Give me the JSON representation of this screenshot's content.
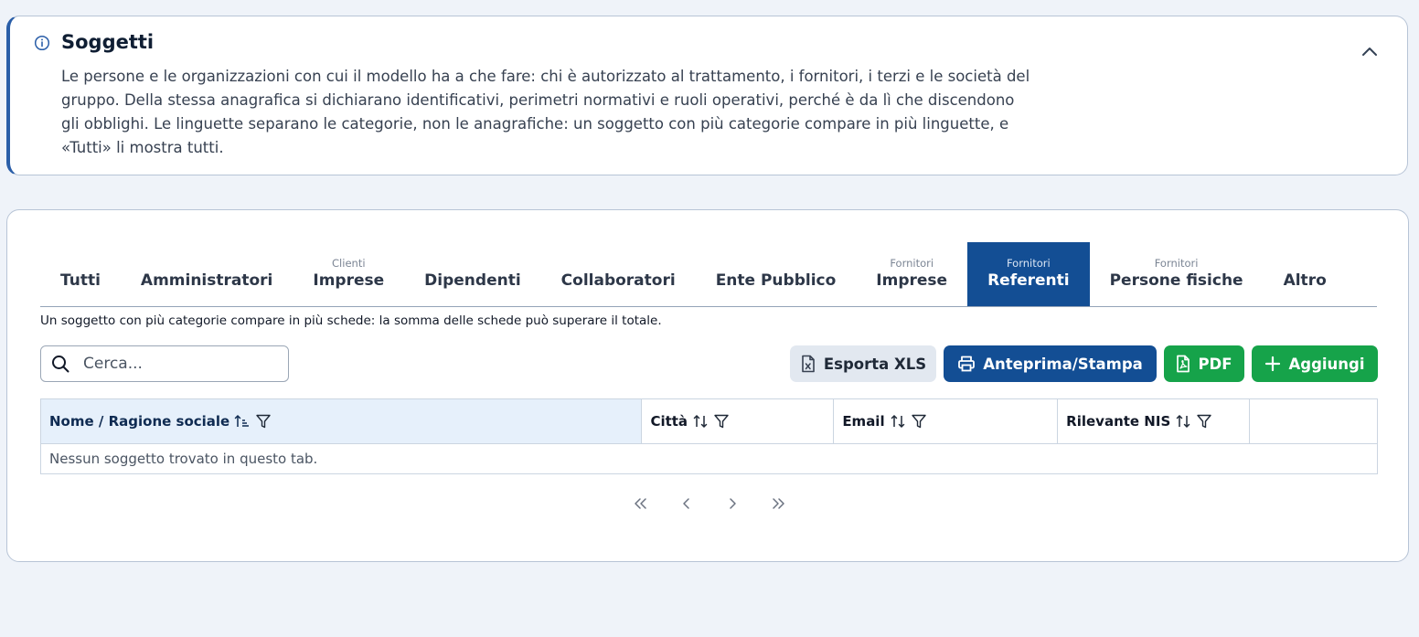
{
  "info": {
    "title": "Soggetti",
    "text": "Le persone e le organizzazioni con cui il modello ha a che fare: chi è autorizzato al trattamento, i fornitori, i terzi e le società del gruppo. Della stessa anagrafica si dichiarano identificativi, perimetri normativi e ruoli operativi, perché è da lì che discendono gli obblighi. Le linguette separano le categorie, non le anagrafiche: un soggetto con più categorie compare in più linguette, e «Tutti» li mostra tutti."
  },
  "tabs": [
    {
      "sub": "",
      "label": "Tutti"
    },
    {
      "sub": "",
      "label": "Amministratori"
    },
    {
      "sub": "Clienti",
      "label": "Imprese"
    },
    {
      "sub": "",
      "label": "Dipendenti"
    },
    {
      "sub": "",
      "label": "Collaboratori"
    },
    {
      "sub": "",
      "label": "Ente Pubblico"
    },
    {
      "sub": "Fornitori",
      "label": "Imprese"
    },
    {
      "sub": "Fornitori",
      "label": "Referenti"
    },
    {
      "sub": "Fornitori",
      "label": "Persone fisiche"
    },
    {
      "sub": "",
      "label": "Altro"
    }
  ],
  "active_tab": 7,
  "note": "Un soggetto con più categorie compare in più schede: la somma delle schede può superare il totale.",
  "search": {
    "placeholder": "Cerca..."
  },
  "toolbar": {
    "xls_label": "Esporta XLS",
    "print_label": "Anteprima/Stampa",
    "pdf_label": "PDF",
    "add_label": "Aggiungi"
  },
  "table": {
    "columns": [
      "Nome / Ragione sociale",
      "Città",
      "Email",
      "Rilevante NIS"
    ],
    "empty_message": "Nessun soggetto trovato in questo tab."
  },
  "colors": {
    "primary": "#134e94",
    "success": "#16a34a",
    "accent_border": "#2a5ea8"
  }
}
